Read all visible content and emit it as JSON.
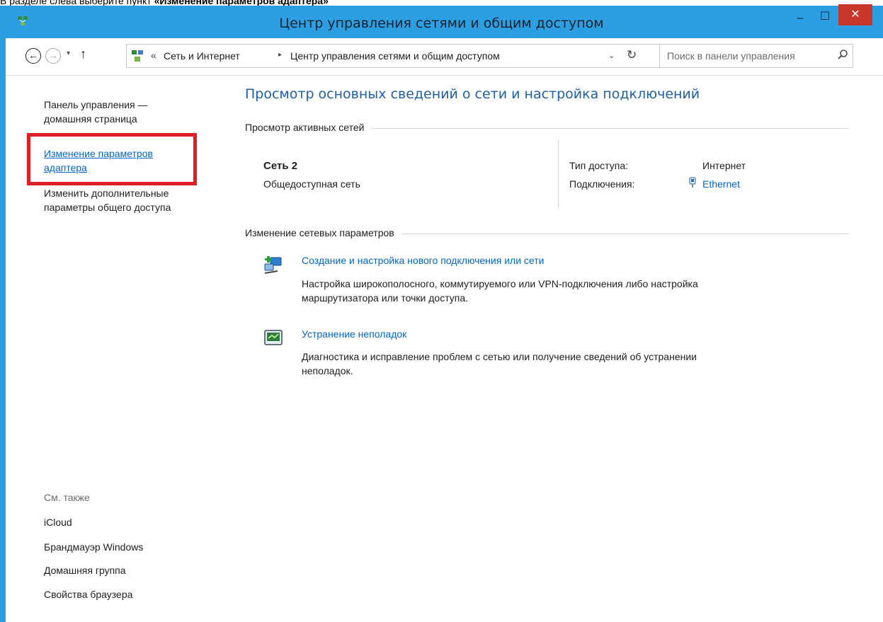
{
  "caption": {
    "prefix": "В разделе слева выберите пункт ",
    "bold": "«Изменение параметров адаптера»"
  },
  "window": {
    "title": "Центр управления сетями и общим доступом",
    "minimize": "–",
    "maximize": "☐",
    "close": "✕"
  },
  "navbar": {
    "back": "←",
    "forward": "→",
    "recent": "▾",
    "up": "↑",
    "breadcrumb_prefix": "«",
    "breadcrumb": [
      "Сеть и Интернет",
      "Центр управления сетями и общим доступом"
    ],
    "separator": "▸",
    "dropdown": "⌄",
    "refresh": "↻",
    "search_placeholder": "Поиск в панели управления"
  },
  "sidebar": {
    "home_line1": "Панель управления —",
    "home_line2": "домашняя страница",
    "adapter_line1": "Изменение параметров",
    "adapter_line2": "адаптера",
    "sharing_line1": "Изменить дополнительные",
    "sharing_line2": "параметры общего доступа",
    "see_also": "См. также",
    "also_items": [
      "iCloud",
      "Брандмауэр Windows",
      "Домашняя группа",
      "Свойства браузера"
    ]
  },
  "main": {
    "title": "Просмотр основных сведений о сети и настройка подключений",
    "active_networks_header": "Просмотр активных сетей",
    "network_name": "Сеть 2",
    "network_type": "Общедоступная сеть",
    "access_type_label": "Тип доступа:",
    "access_type_value": "Интернет",
    "connections_label": "Подключения:",
    "connections_value": "Ethernet",
    "change_settings_header": "Изменение сетевых параметров",
    "tasks": [
      {
        "title": "Создание и настройка нового подключения или сети",
        "desc_line1": "Настройка широкополосного, коммутируемого или VPN-подключения либо настройка",
        "desc_line2": "маршрутизатора или точки доступа.",
        "icon": "network-setup-icon"
      },
      {
        "title": "Устранение неполадок",
        "desc_line1": "Диагностика и исправление проблем с сетью или получение сведений об устранении",
        "desc_line2": "неполадок.",
        "icon": "troubleshoot-icon"
      }
    ]
  },
  "colors": {
    "titlebar": "#2c9fe3",
    "close_button": "#c7372b",
    "link": "#0066cc",
    "heading": "#1e5fa8",
    "highlight": "#e01e26"
  }
}
